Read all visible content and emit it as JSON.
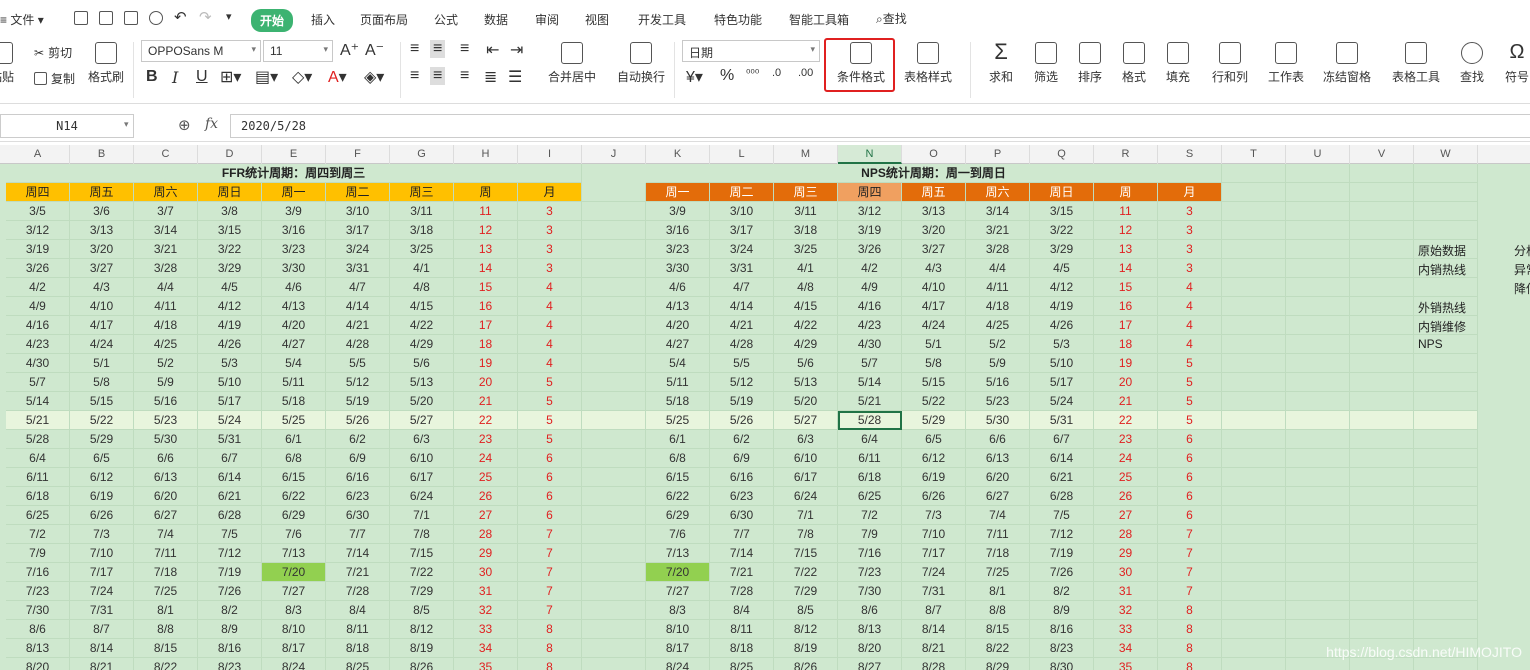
{
  "menubar": {
    "file": "文件",
    "tabs": [
      "开始",
      "插入",
      "页面布局",
      "公式",
      "数据",
      "审阅",
      "视图",
      "开发工具",
      "特色功能",
      "智能工具箱"
    ],
    "search": "查找"
  },
  "ribbon": {
    "paste": "粘贴",
    "cut": "剪切",
    "copy": "复制",
    "format_painter": "格式刷",
    "font_name": "OPPOSans M",
    "font_size": "11",
    "merge_center": "合并居中",
    "wrap_text": "自动换行",
    "number_format": "日期",
    "conditional_format": "条件格式",
    "table_style": "表格样式",
    "sum": "求和",
    "filter": "筛选",
    "sort": "排序",
    "format": "格式",
    "fill": "填充",
    "row_col": "行和列",
    "worksheet": "工作表",
    "freeze": "冻结窗格",
    "table_tools": "表格工具",
    "find": "查找",
    "symbol": "符号"
  },
  "formula_bar": {
    "cell_ref": "N14",
    "fx": "fx",
    "value": "2020/5/28"
  },
  "columns": [
    "A",
    "B",
    "C",
    "D",
    "E",
    "F",
    "G",
    "H",
    "I",
    "J",
    "K",
    "L",
    "M",
    "N",
    "O",
    "P",
    "Q",
    "R",
    "S",
    "T",
    "U",
    "V",
    "W"
  ],
  "ffr": {
    "title": "FFR统计周期：周四到周三",
    "headers": [
      "周四",
      "周五",
      "周六",
      "周日",
      "周一",
      "周二",
      "周三",
      "周",
      "月"
    ],
    "rows": [
      [
        "3/5",
        "3/6",
        "3/7",
        "3/8",
        "3/9",
        "3/10",
        "3/11",
        "11",
        "3"
      ],
      [
        "3/12",
        "3/13",
        "3/14",
        "3/15",
        "3/16",
        "3/17",
        "3/18",
        "12",
        "3"
      ],
      [
        "3/19",
        "3/20",
        "3/21",
        "3/22",
        "3/23",
        "3/24",
        "3/25",
        "13",
        "3"
      ],
      [
        "3/26",
        "3/27",
        "3/28",
        "3/29",
        "3/30",
        "3/31",
        "4/1",
        "14",
        "3"
      ],
      [
        "4/2",
        "4/3",
        "4/4",
        "4/5",
        "4/6",
        "4/7",
        "4/8",
        "15",
        "4"
      ],
      [
        "4/9",
        "4/10",
        "4/11",
        "4/12",
        "4/13",
        "4/14",
        "4/15",
        "16",
        "4"
      ],
      [
        "4/16",
        "4/17",
        "4/18",
        "4/19",
        "4/20",
        "4/21",
        "4/22",
        "17",
        "4"
      ],
      [
        "4/23",
        "4/24",
        "4/25",
        "4/26",
        "4/27",
        "4/28",
        "4/29",
        "18",
        "4"
      ],
      [
        "4/30",
        "5/1",
        "5/2",
        "5/3",
        "5/4",
        "5/5",
        "5/6",
        "19",
        "4"
      ],
      [
        "5/7",
        "5/8",
        "5/9",
        "5/10",
        "5/11",
        "5/12",
        "5/13",
        "20",
        "5"
      ],
      [
        "5/14",
        "5/15",
        "5/16",
        "5/17",
        "5/18",
        "5/19",
        "5/20",
        "21",
        "5"
      ],
      [
        "5/21",
        "5/22",
        "5/23",
        "5/24",
        "5/25",
        "5/26",
        "5/27",
        "22",
        "5"
      ],
      [
        "5/28",
        "5/29",
        "5/30",
        "5/31",
        "6/1",
        "6/2",
        "6/3",
        "23",
        "5"
      ],
      [
        "6/4",
        "6/5",
        "6/6",
        "6/7",
        "6/8",
        "6/9",
        "6/10",
        "24",
        "6"
      ],
      [
        "6/11",
        "6/12",
        "6/13",
        "6/14",
        "6/15",
        "6/16",
        "6/17",
        "25",
        "6"
      ],
      [
        "6/18",
        "6/19",
        "6/20",
        "6/21",
        "6/22",
        "6/23",
        "6/24",
        "26",
        "6"
      ],
      [
        "6/25",
        "6/26",
        "6/27",
        "6/28",
        "6/29",
        "6/30",
        "7/1",
        "27",
        "6"
      ],
      [
        "7/2",
        "7/3",
        "7/4",
        "7/5",
        "7/6",
        "7/7",
        "7/8",
        "28",
        "7"
      ],
      [
        "7/9",
        "7/10",
        "7/11",
        "7/12",
        "7/13",
        "7/14",
        "7/15",
        "29",
        "7"
      ],
      [
        "7/16",
        "7/17",
        "7/18",
        "7/19",
        "7/20",
        "7/21",
        "7/22",
        "30",
        "7"
      ],
      [
        "7/23",
        "7/24",
        "7/25",
        "7/26",
        "7/27",
        "7/28",
        "7/29",
        "31",
        "7"
      ],
      [
        "7/30",
        "7/31",
        "8/1",
        "8/2",
        "8/3",
        "8/4",
        "8/5",
        "32",
        "7"
      ],
      [
        "8/6",
        "8/7",
        "8/8",
        "8/9",
        "8/10",
        "8/11",
        "8/12",
        "33",
        "8"
      ],
      [
        "8/13",
        "8/14",
        "8/15",
        "8/16",
        "8/17",
        "8/18",
        "8/19",
        "34",
        "8"
      ],
      [
        "8/20",
        "8/21",
        "8/22",
        "8/23",
        "8/24",
        "8/25",
        "8/26",
        "35",
        "8"
      ]
    ]
  },
  "nps": {
    "title": "NPS统计周期：周一到周日",
    "headers": [
      "周一",
      "周二",
      "周三",
      "周四",
      "周五",
      "周六",
      "周日",
      "周",
      "月"
    ],
    "rows": [
      [
        "3/9",
        "3/10",
        "3/11",
        "3/12",
        "3/13",
        "3/14",
        "3/15",
        "11",
        "3"
      ],
      [
        "3/16",
        "3/17",
        "3/18",
        "3/19",
        "3/20",
        "3/21",
        "3/22",
        "12",
        "3"
      ],
      [
        "3/23",
        "3/24",
        "3/25",
        "3/26",
        "3/27",
        "3/28",
        "3/29",
        "13",
        "3"
      ],
      [
        "3/30",
        "3/31",
        "4/1",
        "4/2",
        "4/3",
        "4/4",
        "4/5",
        "14",
        "3"
      ],
      [
        "4/6",
        "4/7",
        "4/8",
        "4/9",
        "4/10",
        "4/11",
        "4/12",
        "15",
        "4"
      ],
      [
        "4/13",
        "4/14",
        "4/15",
        "4/16",
        "4/17",
        "4/18",
        "4/19",
        "16",
        "4"
      ],
      [
        "4/20",
        "4/21",
        "4/22",
        "4/23",
        "4/24",
        "4/25",
        "4/26",
        "17",
        "4"
      ],
      [
        "4/27",
        "4/28",
        "4/29",
        "4/30",
        "5/1",
        "5/2",
        "5/3",
        "18",
        "4"
      ],
      [
        "5/4",
        "5/5",
        "5/6",
        "5/7",
        "5/8",
        "5/9",
        "5/10",
        "19",
        "5"
      ],
      [
        "5/11",
        "5/12",
        "5/13",
        "5/14",
        "5/15",
        "5/16",
        "5/17",
        "20",
        "5"
      ],
      [
        "5/18",
        "5/19",
        "5/20",
        "5/21",
        "5/22",
        "5/23",
        "5/24",
        "21",
        "5"
      ],
      [
        "5/25",
        "5/26",
        "5/27",
        "5/28",
        "5/29",
        "5/30",
        "5/31",
        "22",
        "5"
      ],
      [
        "6/1",
        "6/2",
        "6/3",
        "6/4",
        "6/5",
        "6/6",
        "6/7",
        "23",
        "6"
      ],
      [
        "6/8",
        "6/9",
        "6/10",
        "6/11",
        "6/12",
        "6/13",
        "6/14",
        "24",
        "6"
      ],
      [
        "6/15",
        "6/16",
        "6/17",
        "6/18",
        "6/19",
        "6/20",
        "6/21",
        "25",
        "6"
      ],
      [
        "6/22",
        "6/23",
        "6/24",
        "6/25",
        "6/26",
        "6/27",
        "6/28",
        "26",
        "6"
      ],
      [
        "6/29",
        "6/30",
        "7/1",
        "7/2",
        "7/3",
        "7/4",
        "7/5",
        "27",
        "6"
      ],
      [
        "7/6",
        "7/7",
        "7/8",
        "7/9",
        "7/10",
        "7/11",
        "7/12",
        "28",
        "7"
      ],
      [
        "7/13",
        "7/14",
        "7/15",
        "7/16",
        "7/17",
        "7/18",
        "7/19",
        "29",
        "7"
      ],
      [
        "7/20",
        "7/21",
        "7/22",
        "7/23",
        "7/24",
        "7/25",
        "7/26",
        "30",
        "7"
      ],
      [
        "7/27",
        "7/28",
        "7/29",
        "7/30",
        "7/31",
        "8/1",
        "8/2",
        "31",
        "7"
      ],
      [
        "8/3",
        "8/4",
        "8/5",
        "8/6",
        "8/7",
        "8/8",
        "8/9",
        "32",
        "8"
      ],
      [
        "8/10",
        "8/11",
        "8/12",
        "8/13",
        "8/14",
        "8/15",
        "8/16",
        "33",
        "8"
      ],
      [
        "8/17",
        "8/18",
        "8/19",
        "8/20",
        "8/21",
        "8/22",
        "8/23",
        "34",
        "8"
      ],
      [
        "8/24",
        "8/25",
        "8/26",
        "8/27",
        "8/28",
        "8/29",
        "8/30",
        "35",
        "8"
      ]
    ]
  },
  "side_labels": {
    "w": [
      "原始数据",
      "内销热线",
      "外销热线",
      "内销维修",
      "NPS"
    ],
    "x": [
      "分析",
      "异常",
      "降低"
    ]
  },
  "watermark": "https://blog.csdn.net/HIMOJITO"
}
